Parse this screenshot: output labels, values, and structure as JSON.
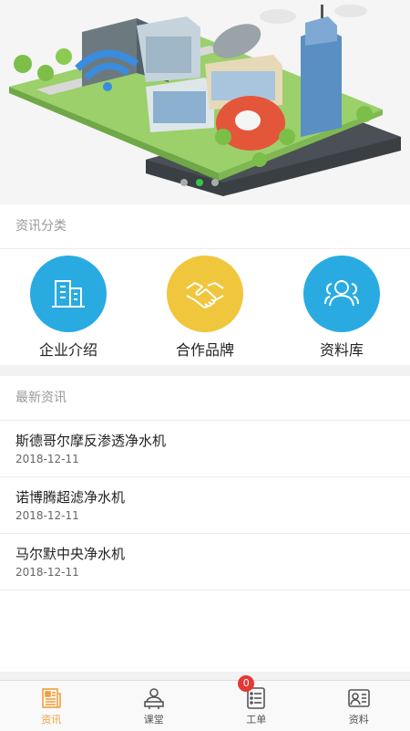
{
  "banner": {
    "active_dot": 1
  },
  "categories": {
    "title": "资讯分类",
    "items": [
      {
        "label": "企业介绍",
        "color": "#29abe2",
        "icon": "building-icon"
      },
      {
        "label": "合作品牌",
        "color": "#f0c63c",
        "icon": "handshake-icon"
      },
      {
        "label": "资料库",
        "color": "#29abe2",
        "icon": "people-icon"
      }
    ]
  },
  "news": {
    "title": "最新资讯",
    "items": [
      {
        "title": "斯德哥尔摩反渗透净水机",
        "date": "2018-12-11"
      },
      {
        "title": "诺博腾超滤净水机",
        "date": "2018-12-11"
      },
      {
        "title": "马尔默中央净水机",
        "date": "2018-12-11"
      }
    ]
  },
  "tabbar": {
    "tabs": [
      {
        "label": "资讯",
        "icon": "newspaper-icon",
        "active": true
      },
      {
        "label": "课堂",
        "icon": "classroom-icon",
        "active": false
      },
      {
        "label": "工单",
        "icon": "work-order-icon",
        "active": false,
        "badge": "0"
      },
      {
        "label": "资料",
        "icon": "profile-card-icon",
        "active": false
      }
    ],
    "active_color": "#f0a03a"
  }
}
